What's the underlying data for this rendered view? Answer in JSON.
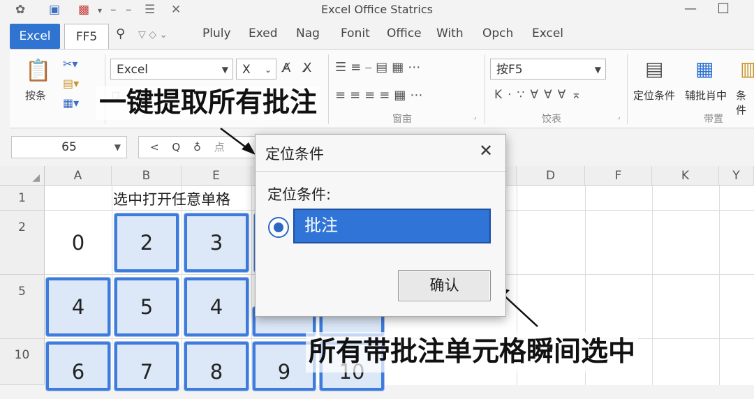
{
  "titlebar": {
    "title": "Excel Office Statrics",
    "qat_icons": [
      "gear-icon",
      "save-icon",
      "calendar-icon",
      "minus",
      "minus",
      "menu-icon",
      "close-small-icon"
    ]
  },
  "tabs": [
    {
      "label": "Excel",
      "active": true
    },
    {
      "label": "FF5",
      "selected": true
    },
    {
      "label": "Pluly"
    },
    {
      "label": "Exed"
    },
    {
      "label": "Nag"
    },
    {
      "label": "Fonit"
    },
    {
      "label": "Office"
    },
    {
      "label": "With"
    },
    {
      "label": "Opch"
    },
    {
      "label": "Excel"
    }
  ],
  "ribbon": {
    "paste_label": "按条",
    "font_name": "Excel",
    "font_size": "X",
    "style_value": "按F5",
    "group_align": "窗亩",
    "group_style": "饺表",
    "group_right": "带置",
    "btn_goto": "定位条件",
    "btn_comments": "辅批肖中",
    "btn_cond": "条件"
  },
  "formula_bar": {
    "name_box": "65",
    "placeholder": "点"
  },
  "grid": {
    "col_headers": [
      "A",
      "B",
      "E",
      "D",
      "F",
      "K",
      "Y"
    ],
    "row_headers": [
      "1",
      "2",
      "5",
      "10"
    ],
    "row1_text": "选中打开任意单格",
    "row2": [
      "0",
      "2",
      "3"
    ],
    "row3": [
      "4",
      "5",
      "4"
    ],
    "row4": [
      "6",
      "7",
      "8",
      "9",
      "10"
    ]
  },
  "annotations": {
    "top": "一键提取所有批注",
    "bottom": "所有带批注单元格瞬间选中"
  },
  "dialog": {
    "title": "定位条件",
    "label": "定位条件:",
    "option": "批注",
    "ok": "确认"
  },
  "colors": {
    "accent": "#2f74d0",
    "cell_border": "#3d7bdc",
    "cell_fill": "#dce8f8"
  }
}
